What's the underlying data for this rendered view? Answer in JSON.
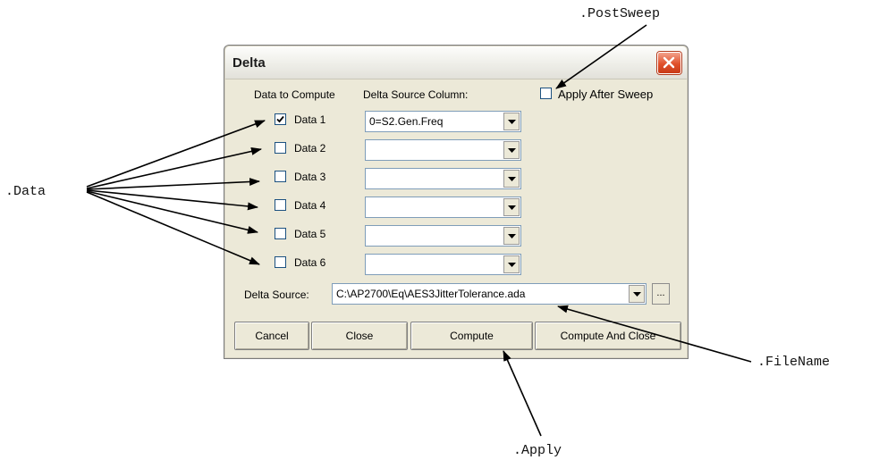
{
  "dialog": {
    "title": "Delta",
    "data_to_compute_label": "Data to Compute",
    "delta_source_column_label": "Delta Source Column:",
    "apply_after_sweep_label": "Apply After Sweep",
    "apply_after_sweep_checked": false,
    "rows": [
      {
        "label": "Data 1",
        "checked": true,
        "column_value": "0=S2.Gen.Freq"
      },
      {
        "label": "Data 2",
        "checked": false,
        "column_value": ""
      },
      {
        "label": "Data 3",
        "checked": false,
        "column_value": ""
      },
      {
        "label": "Data 4",
        "checked": false,
        "column_value": ""
      },
      {
        "label": "Data 5",
        "checked": false,
        "column_value": ""
      },
      {
        "label": "Data 6",
        "checked": false,
        "column_value": ""
      }
    ],
    "delta_source_label": "Delta Source:",
    "delta_source_value": "C:\\AP2700\\Eq\\AES3JitterTolerance.ada",
    "browse_label": "...",
    "buttons": {
      "cancel": "Cancel",
      "close": "Close",
      "compute": "Compute",
      "compute_and_close": "Compute And Close"
    }
  },
  "annotations": {
    "post_sweep": ".PostSweep",
    "data": ".Data",
    "file_name": ".FileName",
    "apply": ".Apply"
  }
}
